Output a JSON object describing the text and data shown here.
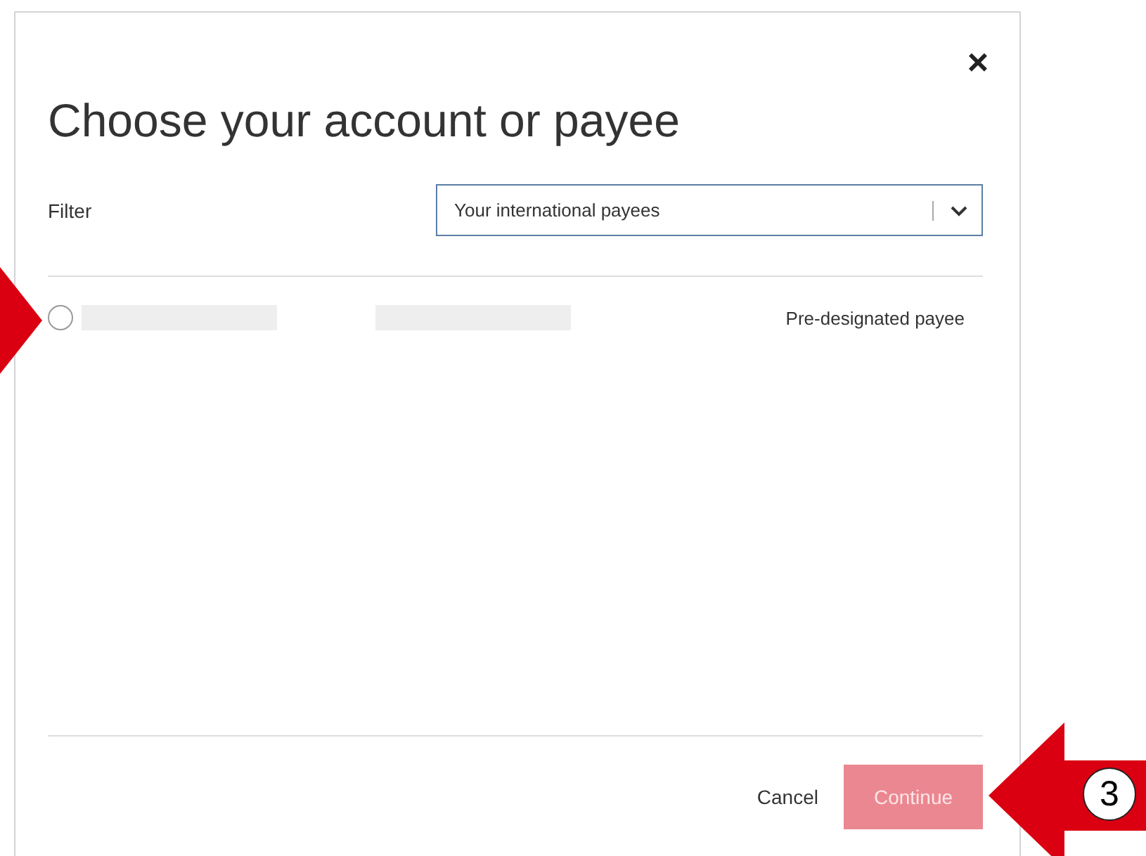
{
  "dialog": {
    "close": "×",
    "title": "Choose your account or payee",
    "filter": {
      "label": "Filter",
      "value": "Your international payees"
    },
    "rows": [
      {
        "selected": false,
        "note": "Pre-designated payee"
      }
    ],
    "buttons": [
      {
        "kind": "link",
        "label": "Cancel",
        "disabled": false
      },
      {
        "kind": "primary",
        "label": "Continue",
        "disabled": true
      }
    ]
  },
  "annotation": {
    "step": "3"
  }
}
